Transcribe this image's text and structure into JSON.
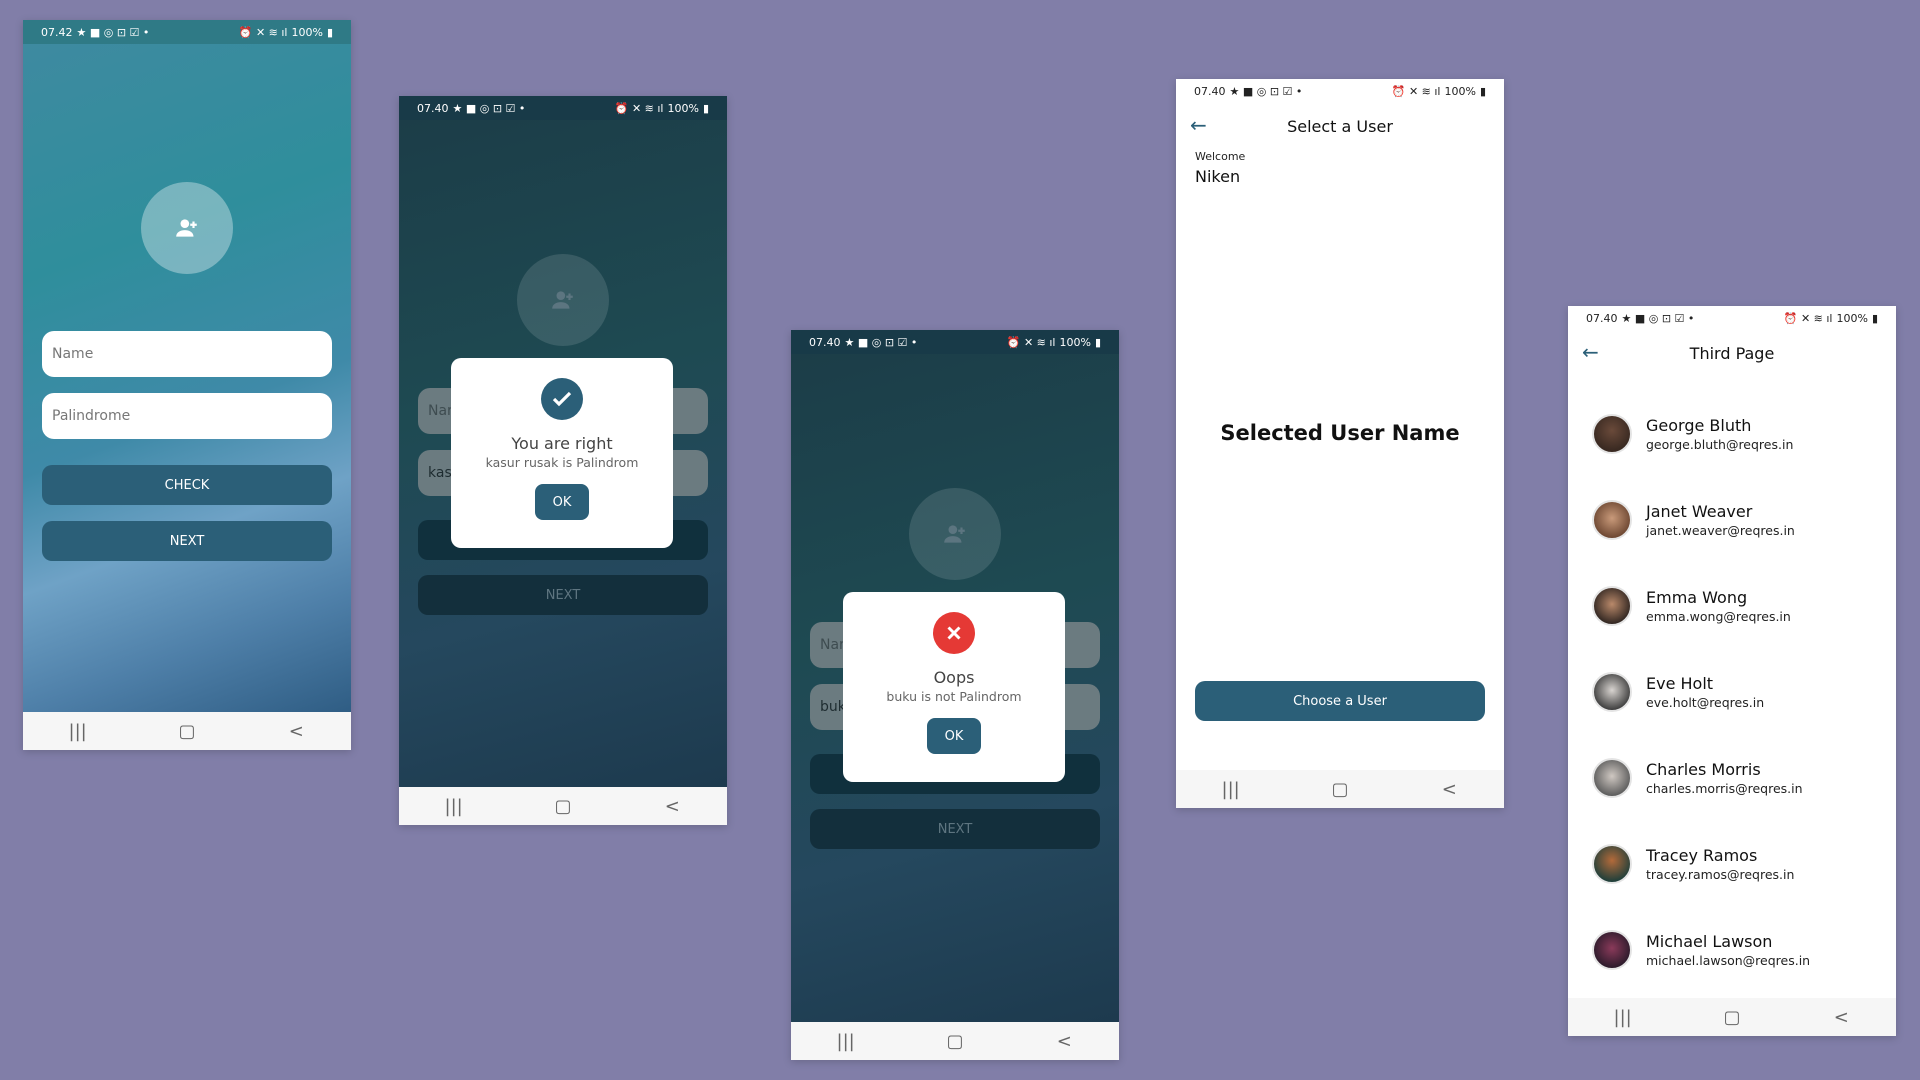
{
  "status": {
    "phone1_time": "07.42",
    "other_time": "07.40",
    "battery": "100%"
  },
  "nav": {
    "recents": "|||",
    "home": "▢",
    "back": "<"
  },
  "screen1": {
    "name_placeholder": "Name",
    "palindrome_placeholder": "Palindrome",
    "check_label": "CHECK",
    "next_label": "NEXT"
  },
  "screen2": {
    "name_partial": "Nar",
    "value_partial": "kas",
    "next_label": "NEXT",
    "dialog": {
      "title": "You are right",
      "message": "kasur rusak is Palindrom",
      "ok_label": "OK"
    }
  },
  "screen3": {
    "name_partial": "Nar",
    "value_partial": "buk",
    "next_label": "NEXT",
    "dialog": {
      "title": "Oops",
      "message": "buku is not Palindrom",
      "ok_label": "OK"
    }
  },
  "screen4": {
    "title": "Select a User",
    "welcome_label": "Welcome",
    "user_name": "Niken",
    "selected_user_label": "Selected User Name",
    "choose_label": "Choose a User"
  },
  "screen5": {
    "title": "Third Page",
    "users": [
      {
        "name": "George Bluth",
        "email": "george.bluth@reqres.in"
      },
      {
        "name": "Janet Weaver",
        "email": "janet.weaver@reqres.in"
      },
      {
        "name": "Emma Wong",
        "email": "emma.wong@reqres.in"
      },
      {
        "name": "Eve Holt",
        "email": "eve.holt@reqres.in"
      },
      {
        "name": "Charles Morris",
        "email": "charles.morris@reqres.in"
      },
      {
        "name": "Tracey Ramos",
        "email": "tracey.ramos@reqres.in"
      },
      {
        "name": "Michael Lawson",
        "email": "michael.lawson@reqres.in"
      }
    ]
  },
  "colors": {
    "background": "#817ea8",
    "primary": "#2b5f78",
    "success": "#2b5f78",
    "error": "#e53935"
  }
}
